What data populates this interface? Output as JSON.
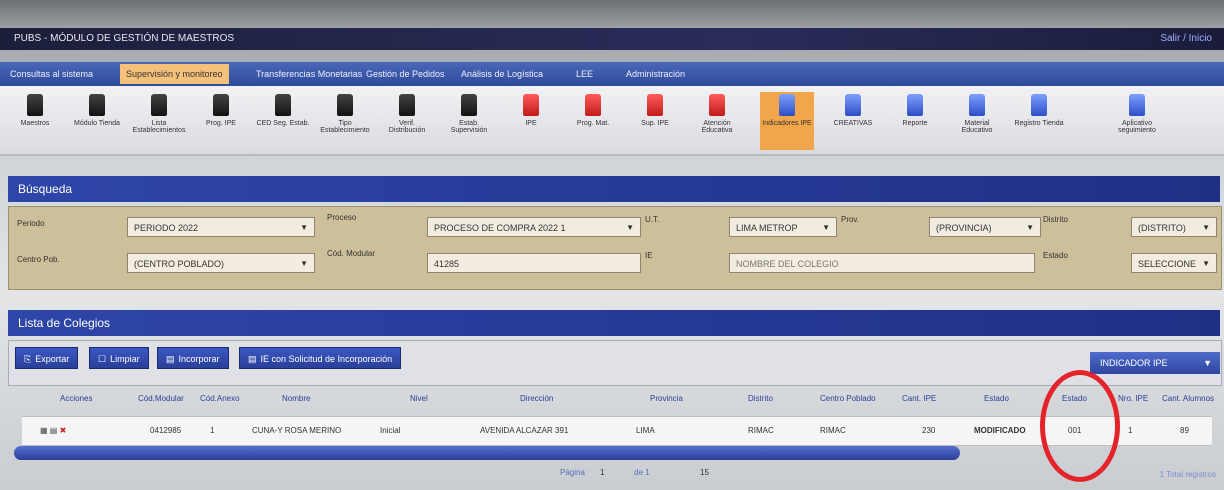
{
  "window": {
    "title": "PUBS - MÓDULO DE GESTIÓN DE MAESTROS",
    "right_link": "Salir / Inicio"
  },
  "tabs": [
    {
      "label": "Consultas al sistema"
    },
    {
      "label": "Supervisión y monitoreo"
    },
    {
      "label": "Transferencias Monetarias"
    },
    {
      "label": "Gestión de Pedidos"
    },
    {
      "label": "Análisis de Logística"
    },
    {
      "label": "LEE"
    },
    {
      "label": "Administración"
    }
  ],
  "toolbar": [
    {
      "label": "Maestros",
      "color": "dark"
    },
    {
      "label": "Módulo Tienda",
      "color": "dark"
    },
    {
      "label": "Lista Establecimientos",
      "color": "dark"
    },
    {
      "label": "Prog. IPE",
      "color": "dark"
    },
    {
      "label": "CED Seg. Estab.",
      "color": "dark"
    },
    {
      "label": "Tipo Establecimiento",
      "color": "dark"
    },
    {
      "label": "Verif. Distribución",
      "color": "dark"
    },
    {
      "label": "Estab. Supervisión",
      "color": "dark"
    },
    {
      "label": "IPE",
      "color": "red"
    },
    {
      "label": "Prog. Mat.",
      "color": "red"
    },
    {
      "label": "Sup. IPE",
      "color": "red"
    },
    {
      "label": "Atención Educativa",
      "color": "red"
    },
    {
      "label": "Indicadores IPE",
      "color": "blue",
      "selected": true
    },
    {
      "label": "CREATIVAS",
      "color": "blue"
    },
    {
      "label": "Reporte",
      "color": "blue"
    },
    {
      "label": "Material Educativo",
      "color": "blue"
    },
    {
      "label": "Registro Tienda",
      "color": "blue"
    },
    {
      "label": "Aplicativo seguimiento",
      "color": "blue"
    }
  ],
  "busqueda": {
    "title": "Búsqueda",
    "row1": {
      "periodo_label": "Periodo",
      "periodo_value": "PERIODO 2022",
      "proceso_label": "Proceso",
      "proceso_value": "PROCESO DE COMPRA 2022 1",
      "ue_label": "U.T.",
      "ue_value": "LIMA METROP",
      "prov_label": "Prov.",
      "prov_value": "(PROVINCIA)",
      "dist_label": "Distrito",
      "dist_value": "(DISTRITO)"
    },
    "row2": {
      "cp_label": "Centro Pob.",
      "cp_value": "(CENTRO POBLADO)",
      "cod_label": "Cód. Modular",
      "cod_value": "41285",
      "ie_label": "IE",
      "ie_placeholder": "NOMBRE DEL COLEGIO",
      "estado_label": "Estado",
      "estado_value": "SELECCIONE"
    }
  },
  "lista": {
    "title": "Lista de Colegios",
    "buttons": [
      "Exportar",
      "Limpiar",
      "Incorporar",
      "IE con Solicitud de Incorporación"
    ],
    "dropdown": "INDICADOR IPE",
    "columns": [
      "Acciones",
      "Cód.Modular",
      "Cód.Anexo",
      "Nombre",
      "Nivel",
      "Dirección",
      "Provincia",
      "Distrito",
      "Centro Poblado",
      "Cant. IPE",
      "Estado",
      "Estado",
      "Nro. IPE",
      "Cant. Alumnos"
    ],
    "row": {
      "cod_modular": "0412985",
      "cod_anexo": "1",
      "nombre": "CUNA-Y ROSA MERINO",
      "nivel": "Inicial",
      "direccion": "AVENIDA ALCAZAR 391",
      "provincia": "LIMA",
      "distrito": "RIMAC",
      "centro_poblado": "RIMAC",
      "cant": "230",
      "estado": "MODIFICADO",
      "estado2": "001",
      "nro": "1",
      "alumnos": "89"
    }
  },
  "pager": {
    "text": "Página",
    "page": "1",
    "of": "de 1",
    "per_page": "15",
    "total": "1 Total registros"
  },
  "colors": {
    "header": "#1f2f86",
    "tab_active": "#f4c07a",
    "circle": "#e3242b"
  }
}
